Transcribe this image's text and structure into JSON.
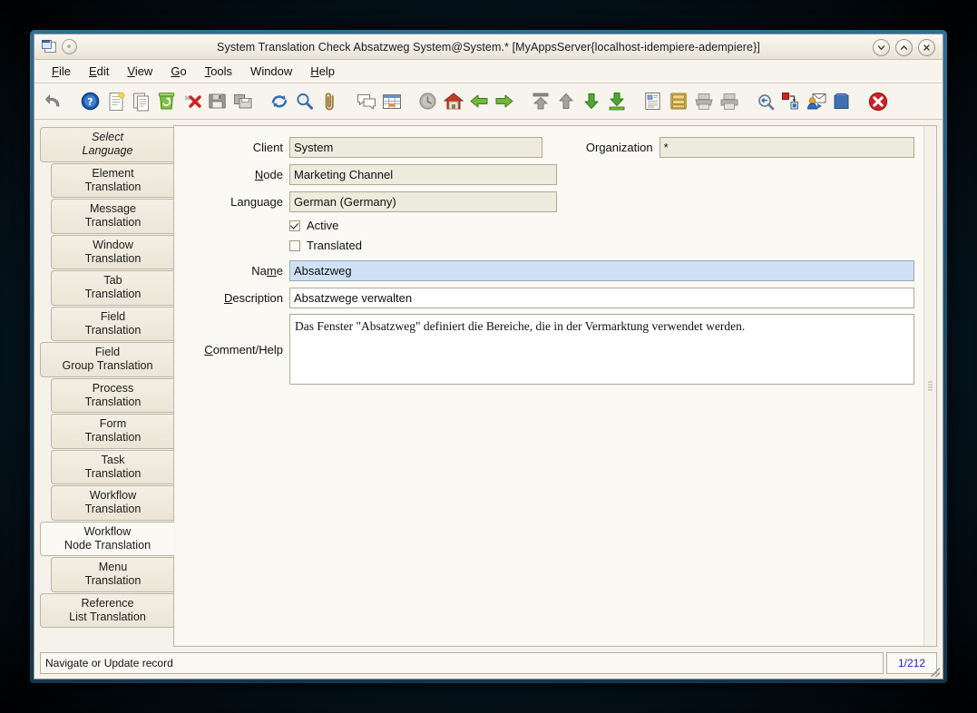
{
  "window": {
    "title": "System Translation Check  Absatzweg  System@System.* [MyAppsServer{localhost-idempiere-adempiere}]",
    "minimize_label": "Minimize",
    "maximize_label": "Maximize",
    "close_label": "Close"
  },
  "menubar": [
    {
      "pre": "",
      "mn": "F",
      "post": "ile",
      "name": "menu-file"
    },
    {
      "pre": "",
      "mn": "E",
      "post": "dit",
      "name": "menu-edit"
    },
    {
      "pre": "",
      "mn": "V",
      "post": "iew",
      "name": "menu-view"
    },
    {
      "pre": "",
      "mn": "G",
      "post": "o",
      "name": "menu-go"
    },
    {
      "pre": "",
      "mn": "T",
      "post": "ools",
      "name": "menu-tools"
    },
    {
      "pre": "Window",
      "mn": "",
      "post": "",
      "name": "menu-window"
    },
    {
      "pre": "",
      "mn": "H",
      "post": "elp",
      "name": "menu-help"
    }
  ],
  "toolbar": [
    {
      "icon": "undo-icon",
      "title": "Undo"
    },
    {
      "icon": "help-icon",
      "title": "Help"
    },
    {
      "icon": "new-record-icon",
      "title": "New Record"
    },
    {
      "icon": "copy-record-icon",
      "title": "Copy Record"
    },
    {
      "icon": "delete-record-icon",
      "title": "Delete Record"
    },
    {
      "icon": "delete-selection-icon",
      "title": "Delete Selection"
    },
    {
      "icon": "save-icon",
      "title": "Save Changes"
    },
    {
      "icon": "save-and-new-icon",
      "title": "Save and Create New"
    },
    {
      "icon": "refresh-icon",
      "title": "Refresh"
    },
    {
      "icon": "find-icon",
      "title": "Find Records"
    },
    {
      "icon": "attachment-icon",
      "title": "Attachment"
    },
    {
      "icon": "chat-icon",
      "title": "Chat"
    },
    {
      "icon": "grid-toggle-icon",
      "title": "Toggle Grid"
    },
    {
      "icon": "history-icon",
      "title": "Request History"
    },
    {
      "icon": "home-icon",
      "title": "Home"
    },
    {
      "icon": "previous-record-icon",
      "title": "Previous Record"
    },
    {
      "icon": "next-record-icon",
      "title": "Next Record"
    },
    {
      "icon": "first-record-icon",
      "title": "First Record"
    },
    {
      "icon": "up-record-icon",
      "title": "Parent Record"
    },
    {
      "icon": "down-record-icon",
      "title": "Detail Record"
    },
    {
      "icon": "last-record-icon",
      "title": "Last Record"
    },
    {
      "icon": "report-icon",
      "title": "Report"
    },
    {
      "icon": "archive-icon",
      "title": "Archived Documents"
    },
    {
      "icon": "print-preview-icon",
      "title": "Print Preview"
    },
    {
      "icon": "print-icon",
      "title": "Print"
    },
    {
      "icon": "zoom-across-icon",
      "title": "Zoom Across"
    },
    {
      "icon": "active-workflow-icon",
      "title": "Active Workflow"
    },
    {
      "icon": "request-icon",
      "title": "Requests"
    },
    {
      "icon": "product-info-icon",
      "title": "Product Info"
    },
    {
      "icon": "exit-icon",
      "title": "Exit"
    }
  ],
  "sidetabs": [
    {
      "l1": "Select",
      "l2": "Language",
      "state": "first",
      "name": "sidebar-tab-select-language"
    },
    {
      "l1": "Element",
      "l2": "Translation",
      "state": "indent",
      "name": "sidebar-tab-element-translation"
    },
    {
      "l1": "Message",
      "l2": "Translation",
      "state": "indent",
      "name": "sidebar-tab-message-translation"
    },
    {
      "l1": "Window",
      "l2": "Translation",
      "state": "indent",
      "name": "sidebar-tab-window-translation"
    },
    {
      "l1": "Tab",
      "l2": "Translation",
      "state": "indent",
      "name": "sidebar-tab-tab-translation"
    },
    {
      "l1": "Field",
      "l2": "Translation",
      "state": "indent",
      "name": "sidebar-tab-field-translation"
    },
    {
      "l1": "Field",
      "l2": "Group Translation",
      "state": "wide",
      "name": "sidebar-tab-field-group-translation"
    },
    {
      "l1": "Process",
      "l2": "Translation",
      "state": "indent",
      "name": "sidebar-tab-process-translation"
    },
    {
      "l1": "Form",
      "l2": "Translation",
      "state": "indent",
      "name": "sidebar-tab-form-translation"
    },
    {
      "l1": "Task",
      "l2": "Translation",
      "state": "indent",
      "name": "sidebar-tab-task-translation"
    },
    {
      "l1": "Workflow",
      "l2": "Translation",
      "state": "indent",
      "name": "sidebar-tab-workflow-translation"
    },
    {
      "l1": "Workflow",
      "l2": "Node Translation",
      "state": "selected",
      "name": "sidebar-tab-workflow-node-translation"
    },
    {
      "l1": "Menu",
      "l2": "Translation",
      "state": "indent",
      "name": "sidebar-tab-menu-translation"
    },
    {
      "l1": "Reference",
      "l2": "List Translation",
      "state": "wide",
      "name": "sidebar-tab-reference-list-translation"
    }
  ],
  "form": {
    "client": {
      "label_pre": "Client",
      "label_mn": "",
      "label_post": "",
      "value": "System"
    },
    "organization": {
      "label_pre": "Organization",
      "label_mn": "",
      "label_post": "",
      "value": "*"
    },
    "node": {
      "label_pre": "",
      "label_mn": "N",
      "label_post": "ode",
      "value": "Marketing Channel"
    },
    "language": {
      "label_pre": "Language",
      "label_mn": "",
      "label_post": "",
      "value": "German (Germany)"
    },
    "active": {
      "label": "Active",
      "checked": "true"
    },
    "translated": {
      "label": "Translated",
      "checked": "false"
    },
    "name": {
      "label_pre": "Na",
      "label_mn": "m",
      "label_post": "e",
      "value": "Absatzweg"
    },
    "description": {
      "label_pre": "",
      "label_mn": "D",
      "label_post": "escription",
      "value": "Absatzwege verwalten"
    },
    "comment": {
      "label_pre": "",
      "label_mn": "C",
      "label_post": "omment/Help",
      "value": "Das Fenster \"Absatzweg\" definiert die Bereiche, die in der Vermarktung verwendet werden."
    }
  },
  "statusbar": {
    "message": "Navigate or Update record",
    "count": "1/212",
    "count_color": "#2323cc"
  }
}
